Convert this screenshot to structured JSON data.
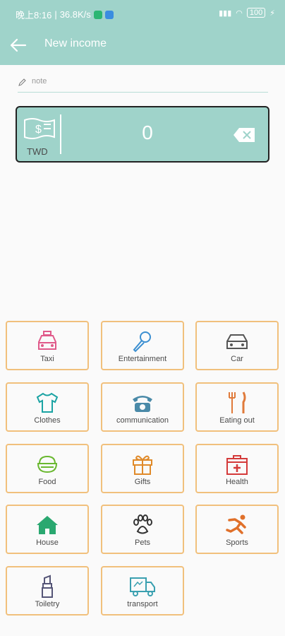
{
  "status": {
    "time": "晚上8:16",
    "speed": "36.8K/s",
    "battery": "100"
  },
  "header": {
    "title": "New income"
  },
  "note": {
    "placeholder": "note"
  },
  "amount": {
    "currency": "TWD",
    "value": "0"
  },
  "categories": [
    {
      "label": "Taxi",
      "icon": "taxi-icon",
      "color": "#e05a8a"
    },
    {
      "label": "Entertainment",
      "icon": "microphone-icon",
      "color": "#3b8fd1"
    },
    {
      "label": "Car",
      "icon": "car-icon",
      "color": "#555555"
    },
    {
      "label": "Clothes",
      "icon": "tshirt-icon",
      "color": "#1aa3a3"
    },
    {
      "label": "communication",
      "icon": "telephone-icon",
      "color": "#4a8aa8"
    },
    {
      "label": "Eating out",
      "icon": "cutlery-icon",
      "color": "#e07a3a"
    },
    {
      "label": "Food",
      "icon": "bowl-icon",
      "color": "#6ab830"
    },
    {
      "label": "Gifts",
      "icon": "gift-icon",
      "color": "#e08a2a"
    },
    {
      "label": "Health",
      "icon": "medical-kit-icon",
      "color": "#d43a3a"
    },
    {
      "label": "House",
      "icon": "house-icon",
      "color": "#2aa870"
    },
    {
      "label": "Pets",
      "icon": "paw-icon",
      "color": "#333333"
    },
    {
      "label": "Sports",
      "icon": "runner-icon",
      "color": "#e0702a"
    },
    {
      "label": "Toiletry",
      "icon": "lipstick-icon",
      "color": "#555577"
    },
    {
      "label": "transport",
      "icon": "truck-icon",
      "color": "#3aa0b0"
    }
  ]
}
